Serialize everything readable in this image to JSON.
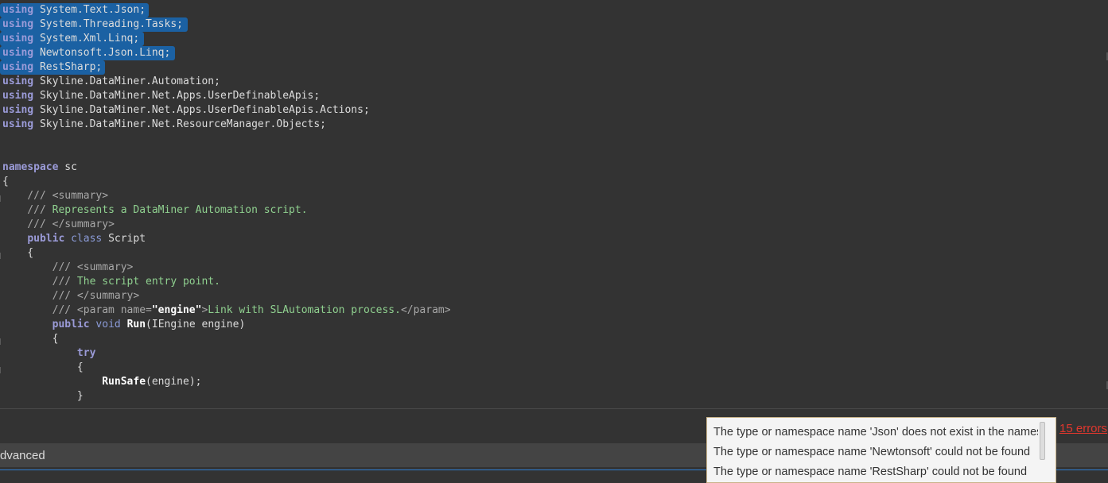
{
  "code": {
    "l1_kw": "using",
    "l1_ns": " System.Text.Json;",
    "l2_kw": "using",
    "l2_ns": " System.Threading.Tasks;",
    "l3_kw": "using",
    "l3_ns": " System.Xml.Linq;",
    "l4_kw": "using",
    "l4_ns": " Newtonsoft.Json.Linq;",
    "l5_kw": "using",
    "l5_ns": " RestSharp;",
    "l6_kw": "using",
    "l6_ns": " Skyline.DataMiner.Automation;",
    "l7_kw": "using",
    "l7_ns": " Skyline.DataMiner.Net.Apps.UserDefinableApis;",
    "l8_kw": "using",
    "l8_ns": " Skyline.DataMiner.Net.Apps.UserDefinableApis.Actions;",
    "l9_kw": "using",
    "l9_ns": " Skyline.DataMiner.Net.ResourceManager.Objects;",
    "ns_kw": "namespace",
    "ns_name": " sc",
    "brace_open": "{",
    "c1_slash": "    /// ",
    "c1_tag": "<summary>",
    "c2_slash": "    /// ",
    "c2_text": "Represents a DataMiner Automation script.",
    "c3_slash": "    /// ",
    "c3_tag": "</summary>",
    "cls_indent": "    ",
    "cls_kw1": "public",
    "cls_kw2": " class",
    "cls_name": " Script",
    "cls_brace": "    {",
    "m1_slash": "        /// ",
    "m1_tag": "<summary>",
    "m2_slash": "        /// ",
    "m2_text": "The script entry point.",
    "m3_slash": "        /// ",
    "m3_tag": "</summary>",
    "p_slash": "        /// ",
    "p_tag_open": "<param name=",
    "p_str": "\"engine\"",
    "p_gt": ">",
    "p_text": "Link with SLAutomation process.",
    "p_tag_close": "</param>",
    "run_indent": "        ",
    "run_kw1": "public",
    "run_kw2": " void",
    "run_sp": " ",
    "run_fn": "Run",
    "run_args": "(IEngine engine)",
    "run_brace": "        {",
    "try_indent": "            ",
    "try_kw": "try",
    "try_brace": "            {",
    "safe_indent": "                ",
    "safe_fn": "RunSafe",
    "safe_args": "(engine);",
    "tail": "            }"
  },
  "bottom_panel": {
    "advanced_label": "dvanced"
  },
  "errors": {
    "count_link": "15 errors",
    "items": [
      "The type or namespace name 'Json' does not exist in the namespace 'System.Text'",
      "The type or namespace name 'Newtonsoft' could not be found",
      "The type or namespace name 'RestSharp' could not be found"
    ]
  }
}
